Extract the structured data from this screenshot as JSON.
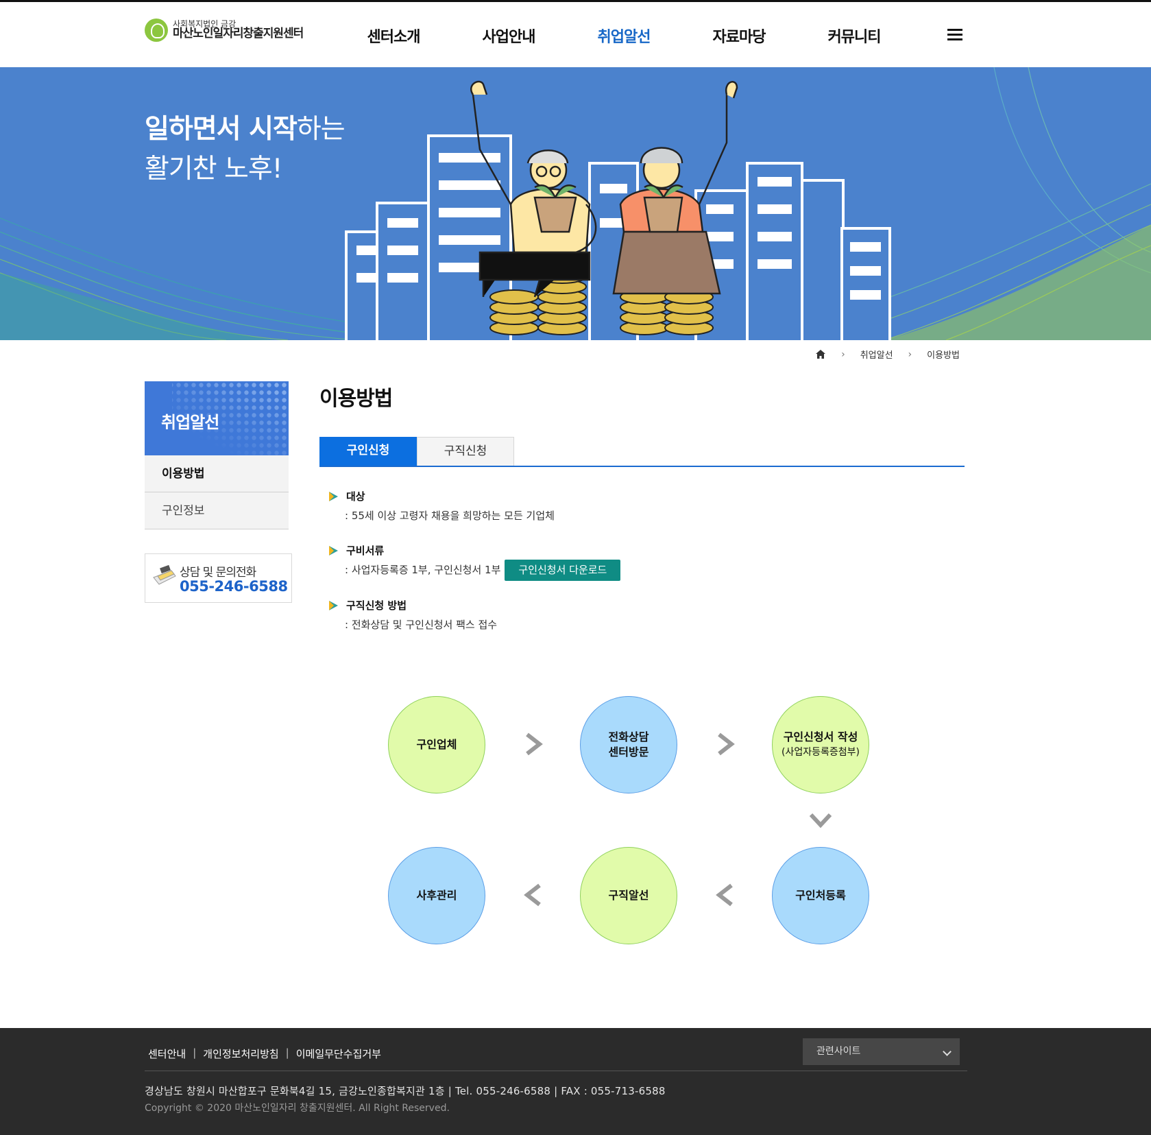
{
  "logo": {
    "sub": "사회복지법인 금강",
    "main": "마산노인일자리창출지원센터"
  },
  "nav": {
    "items": [
      {
        "label": "센터소개"
      },
      {
        "label": "사업안내"
      },
      {
        "label": "취업알선",
        "active": true
      },
      {
        "label": "자료마당"
      },
      {
        "label": "커뮤니티"
      }
    ],
    "menu_icon": "hamburger-icon"
  },
  "hero": {
    "line1_bold": "일하면서 시작",
    "line1_thin": "하는",
    "line2": "활기찬 노후!"
  },
  "breadcrumb": {
    "home_icon": "home-icon",
    "items": [
      "취업알선",
      "이용방법"
    ]
  },
  "sidebar": {
    "title": "취업알선",
    "items": [
      {
        "label": "이용방법",
        "active": true
      },
      {
        "label": "구인정보"
      }
    ],
    "contact": {
      "label": "상담 및 문의전화",
      "phone": "055-246-6588",
      "icon": "phone-icon"
    }
  },
  "content": {
    "title": "이용방법",
    "tabs": [
      {
        "label": "구인신청",
        "active": true
      },
      {
        "label": "구직신청"
      }
    ],
    "sections": [
      {
        "title": "대상",
        "desc": ": 55세 이상 고령자 채용을 희망하는 모든 기업체"
      },
      {
        "title": "구비서류",
        "desc": ": 사업자등록증 1부, 구인신청서 1부",
        "button": "구인신청서 다운로드"
      },
      {
        "title": "구직신청 방법",
        "desc": ": 전화상담 및 구인신청서 팩스 접수"
      }
    ]
  },
  "flow": {
    "step1": "구인업체",
    "step2_line1": "전화상담",
    "step2_line2": "센터방문",
    "step3_line1": "구인신청서 작성",
    "step3_line2": "(사업자등록증첨부)",
    "step4": "구인처등록",
    "step5": "구직알선",
    "step6": "사후관리"
  },
  "footer": {
    "links": [
      "센터안내",
      "개인정보처리방침",
      "이메일무단수집거부"
    ],
    "related_label": "관련사이트",
    "address": "경상남도 창원시 마산합포구 문화북4길 15, 금강노인종합복지관 1층 | Tel. 055-246-6588 | FAX : 055-713-6588",
    "copyright": "Copyright © 2020 마산노인일자리 창출지원센터. All Right Reserved."
  },
  "colors": {
    "brand_blue": "#1767c7",
    "hero_bg": "#4b82cd",
    "tab_active": "#0c6fe0",
    "download_btn": "#0f8c84",
    "circle_green": "#e1fbaa",
    "circle_blue": "#a9dafc",
    "footer_bg": "#2b2b2b"
  }
}
